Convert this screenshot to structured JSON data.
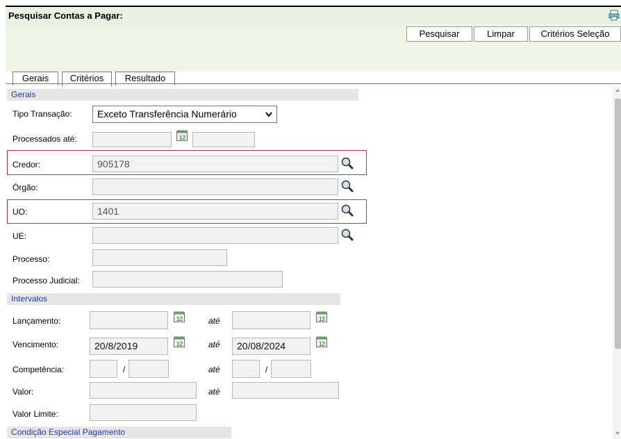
{
  "header": {
    "title": "Pesquisar Contas a Pagar:"
  },
  "toolbar": {
    "search": "Pesquisar",
    "clear": "Limpar",
    "criteria": "Critérios Seleção"
  },
  "tabs": [
    "Gerais",
    "Critérios",
    "Resultado"
  ],
  "sections": {
    "gerais": "Gerais",
    "intervalos": "Intervalos",
    "condicao": "Condição Especial Pagamento"
  },
  "labels": {
    "tipo_transacao": "Tipo Transação:",
    "processados_ate": "Processados até:",
    "credor": "Credor:",
    "orgao": "Órgão:",
    "uo": "UO:",
    "ue": "UE:",
    "processo": "Processo:",
    "processo_judicial": "Processo Judicial:",
    "lancamento": "Lançamento:",
    "vencimento": "Vencimento:",
    "competencia": "Competência:",
    "valor": "Valor:",
    "valor_limite": "Valor Limite:",
    "ate": "até",
    "slash": "/"
  },
  "values": {
    "tipo_transacao": "Exceto Transferência Numerário",
    "credor": "905178",
    "uo": "1401",
    "vencimento_de": "20/8/2019",
    "vencimento_ate": "20/08/2024"
  },
  "colors": {
    "header_bg": "#e8f1e2",
    "section_text": "#1f3bb5",
    "highlight": "#c0313a"
  }
}
